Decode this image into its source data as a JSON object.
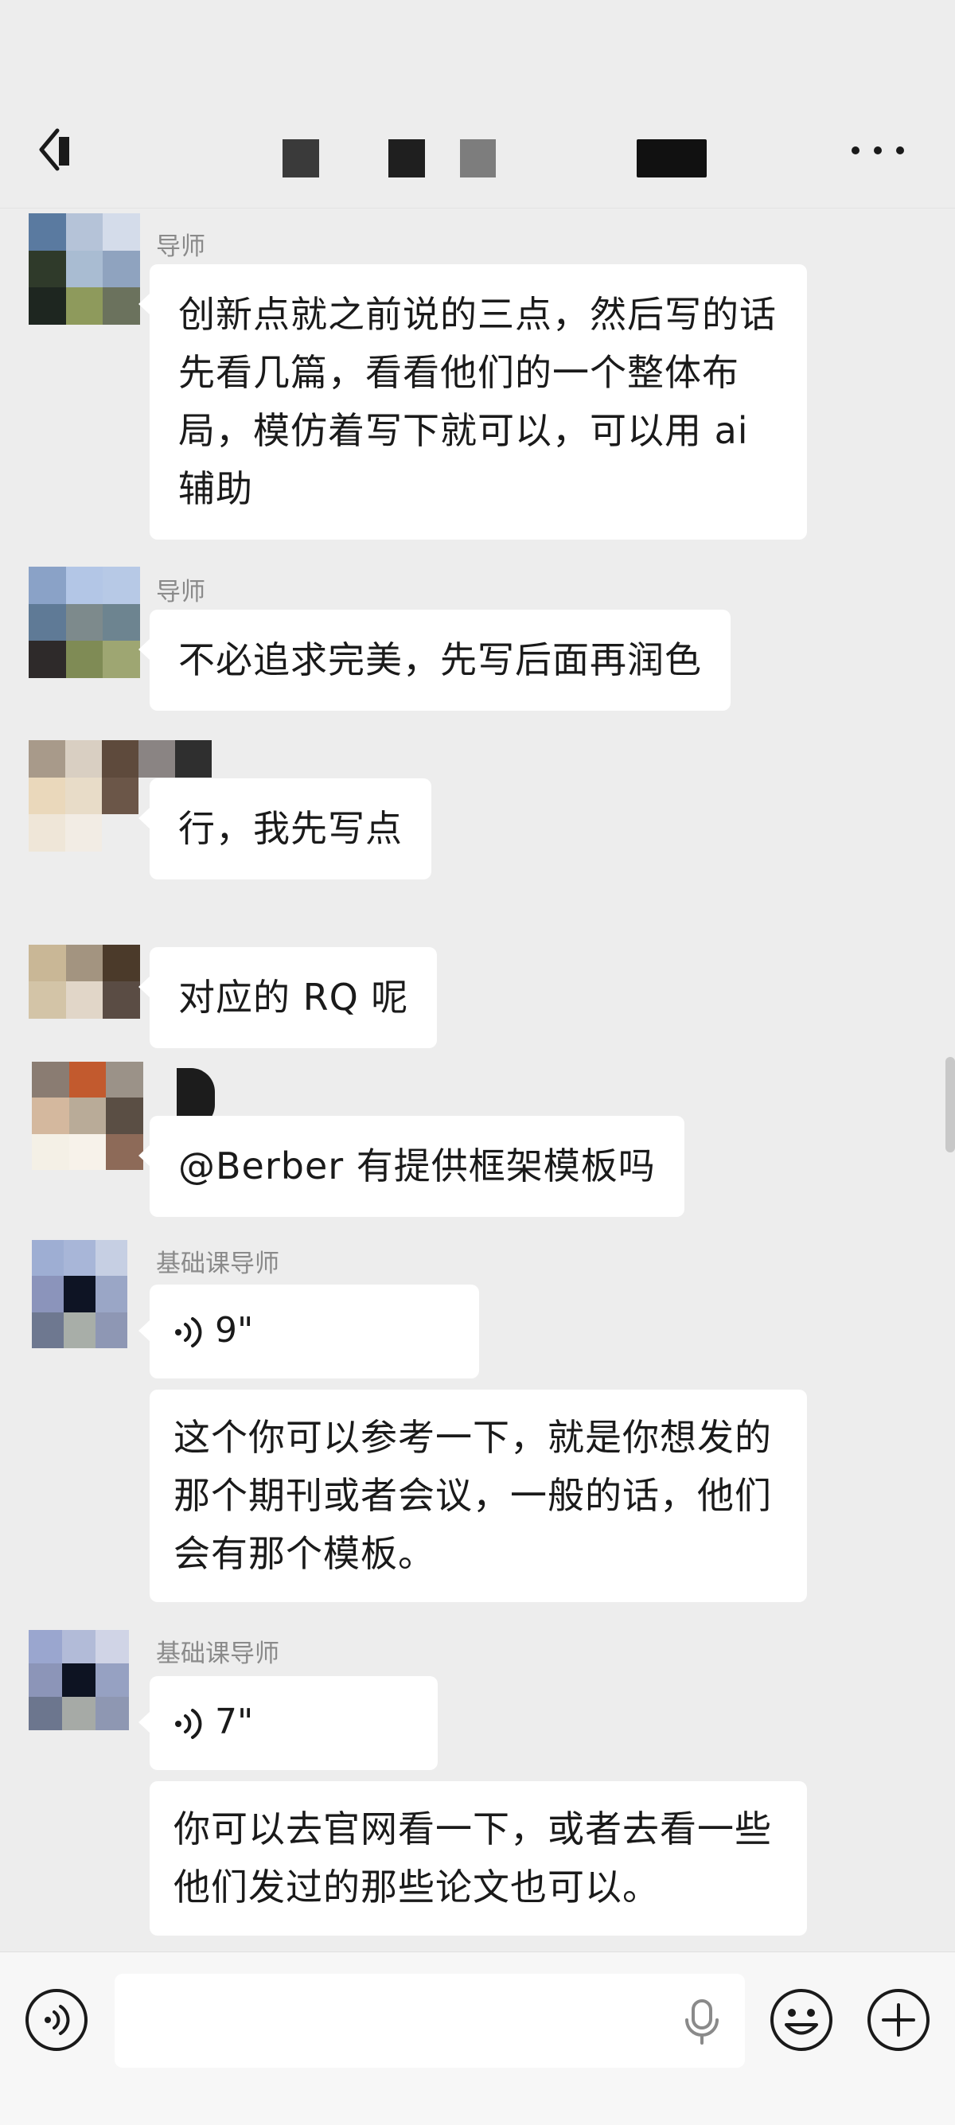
{
  "header": {
    "back_icon": "chevron-left-icon",
    "more_icon": "more-dots-icon"
  },
  "messages": [
    {
      "sender": "导师",
      "text": "创新点就之前说的三点，然后写的话先看几篇，看看他们的一个整体布局，模仿着写下就可以，可以用 ai 辅助"
    },
    {
      "sender": "导师",
      "text": "不必追求完美，先写后面再润色"
    },
    {
      "sender": "",
      "text": "行，我先写点"
    },
    {
      "sender": "",
      "text": "对应的 RQ 呢"
    },
    {
      "sender": "",
      "text": "@Berber  有提供框架模板吗"
    },
    {
      "sender": "基础课导师",
      "voice_duration": "9\"",
      "text": "这个你可以参考一下，就是你想发的那个期刊或者会议，一般的话，他们会有那个模板。"
    },
    {
      "sender": "基础课导师",
      "voice_duration": "7\"",
      "text": "你可以去官网看一下，或者去看一些他们发过的那些论文也可以。"
    }
  ],
  "input": {
    "value": "",
    "voice_icon": "voice-input-icon",
    "mic_icon": "microphone-icon",
    "emoji_icon": "emoji-icon",
    "plus_icon": "plus-icon"
  },
  "colors": {
    "background": "#ededed",
    "bubble": "#ffffff",
    "sender_name": "#8a8a8a",
    "bottom_bar": "#f7f7f7"
  }
}
